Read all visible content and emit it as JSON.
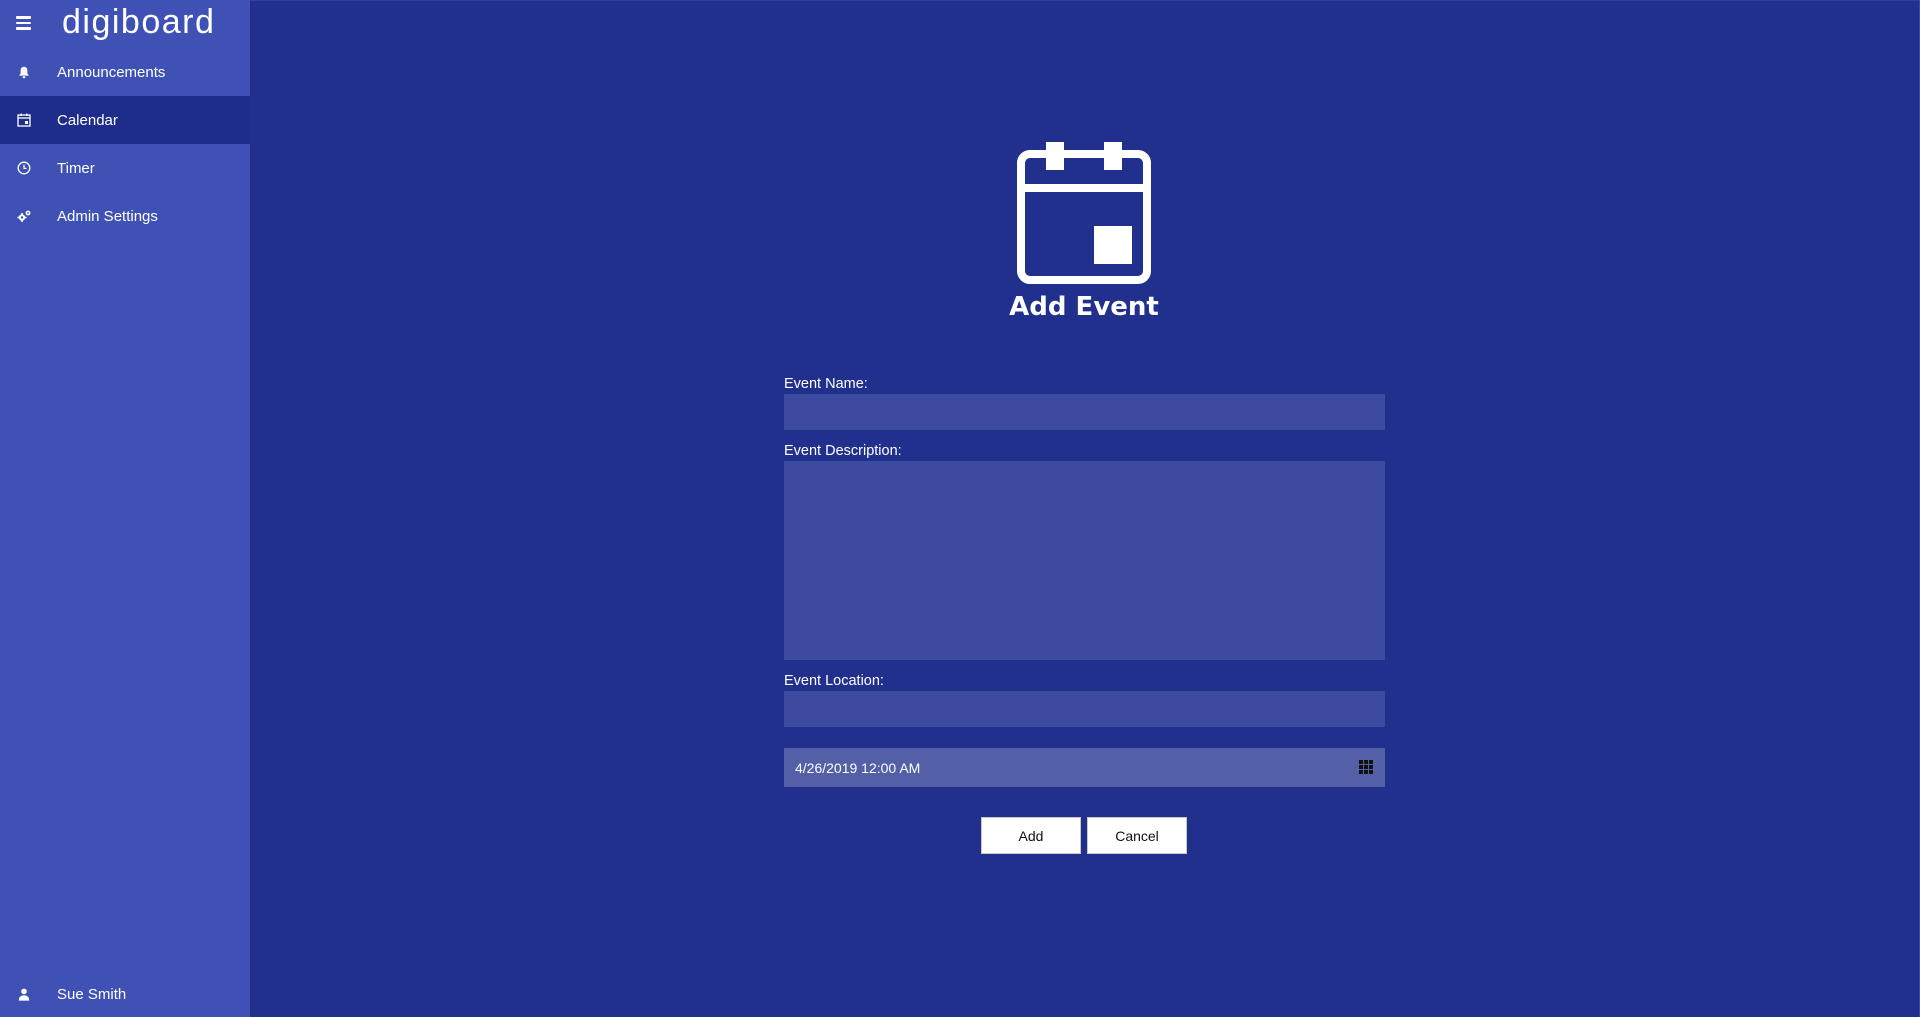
{
  "app": {
    "brand": "digiboard"
  },
  "sidebar": {
    "items": [
      {
        "label": "Announcements",
        "icon": "bell-icon"
      },
      {
        "label": "Calendar",
        "icon": "calendar-icon",
        "active": true
      },
      {
        "label": "Timer",
        "icon": "clock-icon"
      },
      {
        "label": "Admin Settings",
        "icon": "gears-icon"
      }
    ],
    "user": {
      "label": "Sue Smith",
      "icon": "user-icon"
    }
  },
  "main": {
    "title": "Add Event",
    "hero_icon": "calendar-icon",
    "form": {
      "event_name_label": "Event Name:",
      "event_name_value": "",
      "event_description_label": "Event Description:",
      "event_description_value": "",
      "event_location_label": "Event Location:",
      "event_location_value": "",
      "date_value": "4/26/2019 12:00 AM",
      "date_icon": "calendar-grid-icon"
    },
    "buttons": {
      "add_label": "Add",
      "cancel_label": "Cancel"
    }
  },
  "colors": {
    "sidebar_bg": "#3f51b5",
    "sidebar_active_bg": "#1f2d8a",
    "main_bg": "#20308c",
    "input_bg": "#3c4a9f",
    "date_bg": "#535fa6"
  }
}
